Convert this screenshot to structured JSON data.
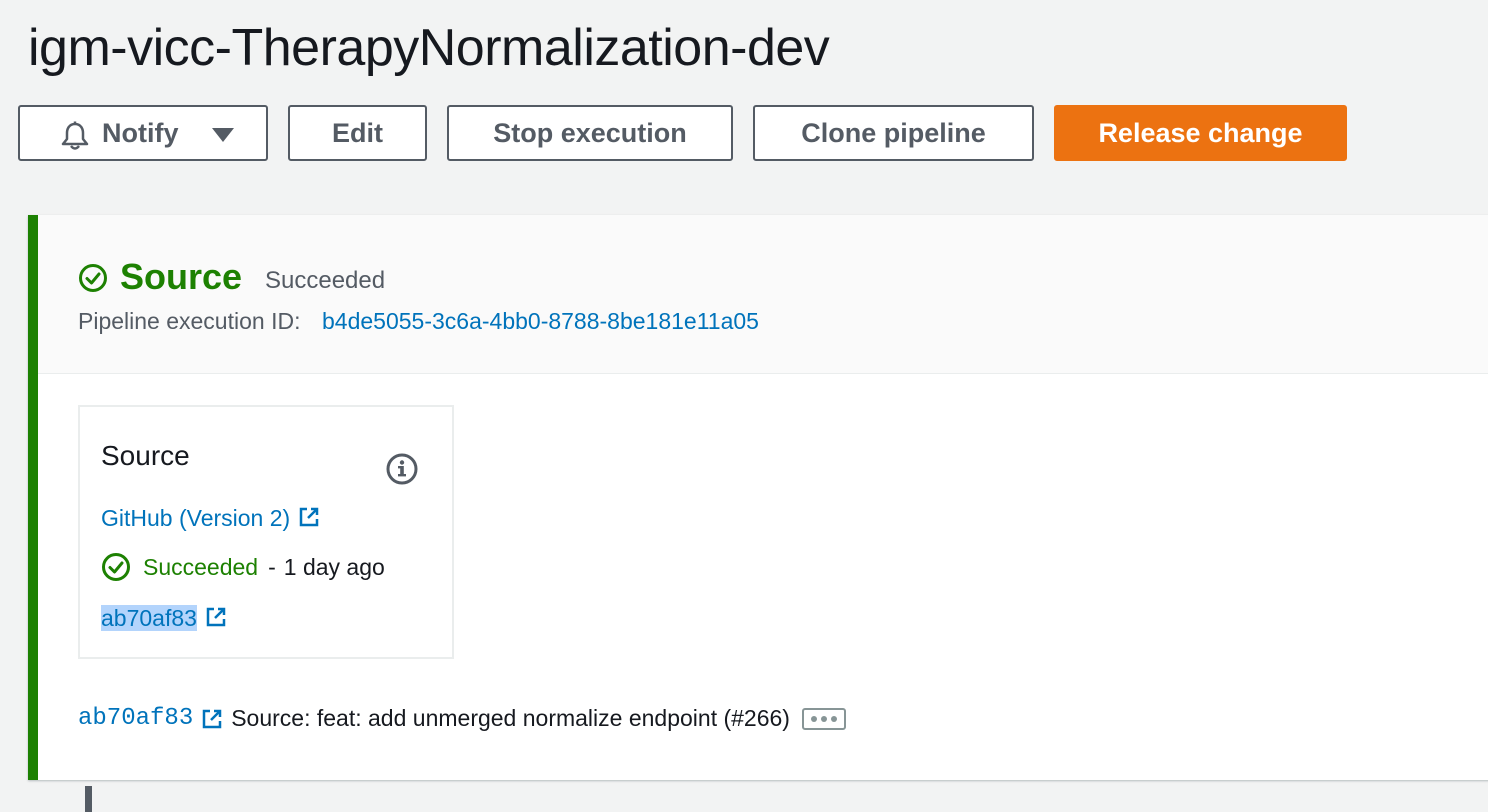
{
  "page": {
    "title": "igm-vicc-TherapyNormalization-dev"
  },
  "toolbar": {
    "notify_label": "Notify",
    "edit_label": "Edit",
    "stop_label": "Stop execution",
    "clone_label": "Clone pipeline",
    "release_label": "Release change"
  },
  "stage": {
    "name": "Source",
    "status": "Succeeded",
    "execution_id_label": "Pipeline execution ID:",
    "execution_id": "b4de5055-3c6a-4bb0-8788-8be181e11a05",
    "action": {
      "name": "Source",
      "provider": "GitHub (Version 2)",
      "status": "Succeeded",
      "separator": "-",
      "time_ago": "1 day ago",
      "commit": "ab70af83"
    },
    "revision": {
      "commit": "ab70af83",
      "message": "Source: feat: add unmerged normalize endpoint (#266)"
    }
  },
  "colors": {
    "success": "#1d8102",
    "link": "#0073bb",
    "primary_button": "#ec7211",
    "text": "#16191f",
    "secondary_text": "#545b64"
  },
  "icons": {
    "notify": "bell-icon",
    "dropdown": "caret-down-icon",
    "status": "check-circle-icon",
    "info": "info-icon",
    "external": "external-link-icon",
    "more": "more-icon"
  }
}
